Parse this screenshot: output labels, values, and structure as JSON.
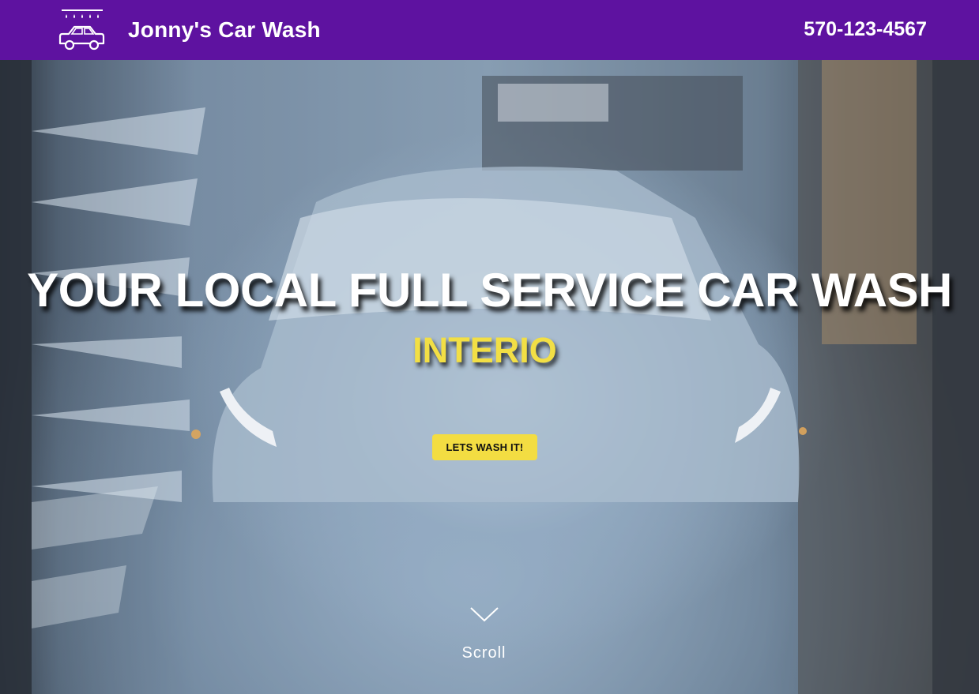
{
  "header": {
    "brand": "Jonny's Car Wash",
    "phone": "570-123-4567",
    "logo_icon": "car-wash-icon",
    "background_color": "#5e12a0"
  },
  "hero": {
    "headline": "YOUR LOCAL FULL SERVICE CAR WASH",
    "subheadline": "INTERIO",
    "cta_label": "LETS WASH IT!",
    "scroll_label": "Scroll",
    "scroll_icon": "chevron-down-icon",
    "accent_color": "#f3dd42"
  }
}
